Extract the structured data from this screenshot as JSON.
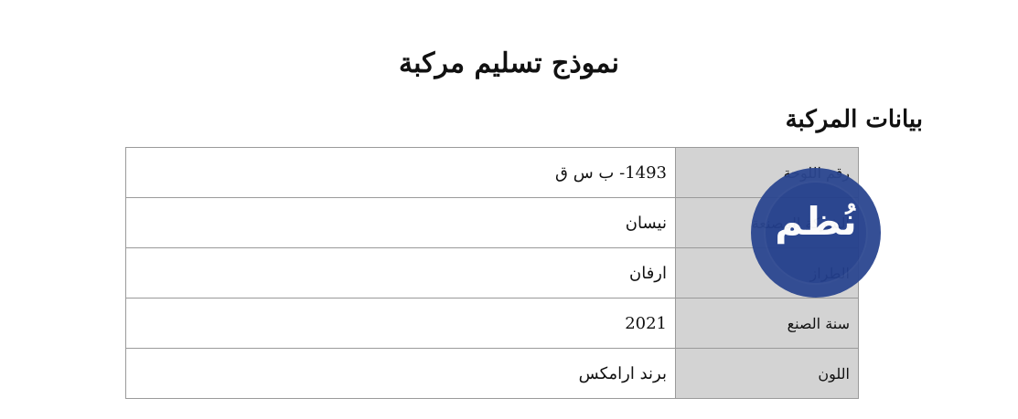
{
  "document": {
    "title": "نموذج تسليم مركبة",
    "section_title": "بيانات المركبة"
  },
  "vehicle_table": {
    "rows": [
      {
        "label": "رقم اللوحة",
        "value": "1493- ب س ق"
      },
      {
        "label": "الشركة المصنعة",
        "value": "نيسان"
      },
      {
        "label": "الطراز",
        "value": "ارفان"
      },
      {
        "label": "سنة الصنع",
        "value": "2021"
      },
      {
        "label": "اللون",
        "value": "برند ارامكس"
      }
    ]
  },
  "logo": {
    "text": "نُظم",
    "color": "#233f8c"
  }
}
